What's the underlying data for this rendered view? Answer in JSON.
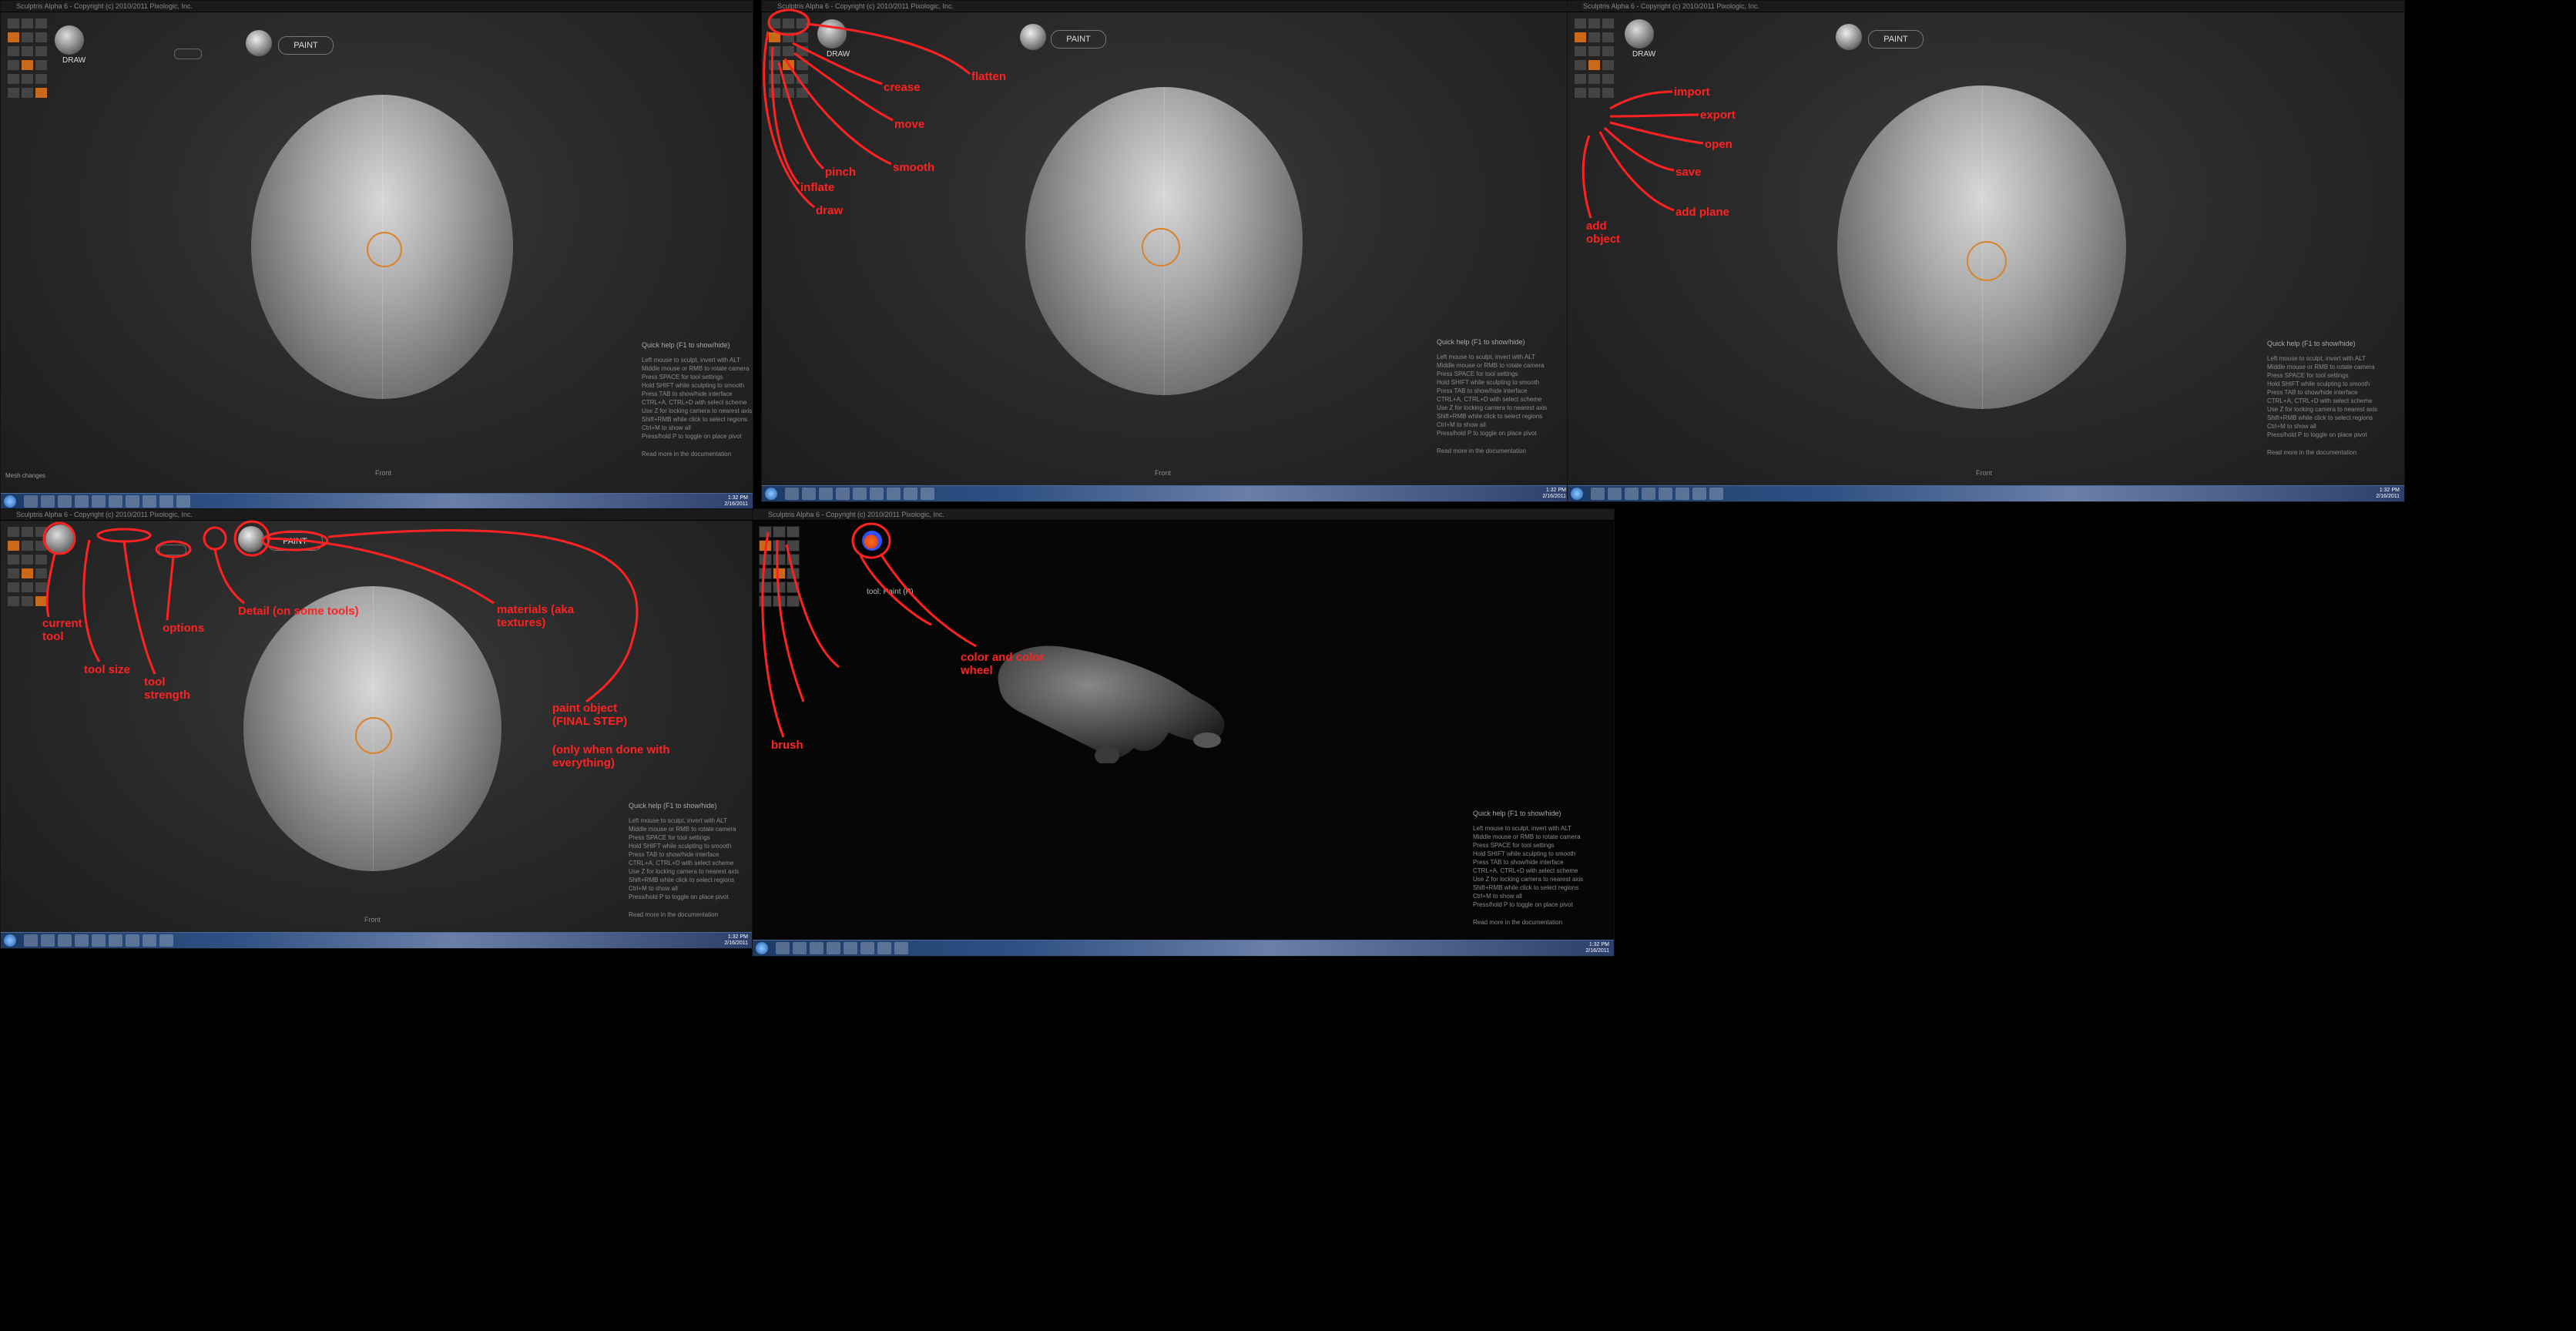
{
  "app": {
    "title": "Sculptris Alpha 6 - Copyright (c) 2010/2011 Pixologic, Inc.",
    "brush_label": "DRAW",
    "paint_button": "PAINT",
    "paint_button_alt": "PAINT",
    "status_left": "Mesh changes",
    "view_label": "Front",
    "quick_help": {
      "title": "Quick help (F1 to show/hide)",
      "lines": [
        "Left mouse to sculpt, invert with ALT",
        "Middle mouse or RMB to rotate camera",
        "Press SPACE for tool settings",
        "Hold SHIFT while sculpting to smooth",
        "Press TAB to show/hide interface",
        "CTRL+A, CTRL+D with select scheme",
        "Use Z for locking camera to nearest axis",
        "Shift+RMB while click to select regions",
        "Ctrl+M to show all",
        "Press/hold P to toggle on place pivot"
      ],
      "footer": "Read more in the documentation"
    },
    "taskbar_clock_time": "1:32 PM",
    "taskbar_clock_date": "2/16/2011"
  },
  "panel_annotations": {
    "top_middle": {
      "flatten": "flatten",
      "crease": "crease",
      "move": "move",
      "smooth": "smooth",
      "pinch": "pinch",
      "inflate": "inflate",
      "draw": "draw"
    },
    "top_right": {
      "import": "import",
      "export": "export",
      "open": "open",
      "save": "save",
      "add_plane": "add plane",
      "add_object": "add object"
    },
    "bottom_left": {
      "current_tool": "current tool",
      "tool_size": "tool size",
      "tool_strength": "tool strength",
      "options": "options",
      "detail": "Detail (on some tools)",
      "materials": "materials (aka textures)",
      "paint_object": "paint object (FINAL STEP)",
      "paint_note": "(only when done with everything)"
    },
    "bottom_middle": {
      "brush": "brush",
      "color": "color and color wheel",
      "tool_hint": "tool: Paint (P)"
    }
  },
  "colors": {
    "annotation": "#ff2222",
    "accent_orange": "#d9822b",
    "background": "#000000"
  }
}
